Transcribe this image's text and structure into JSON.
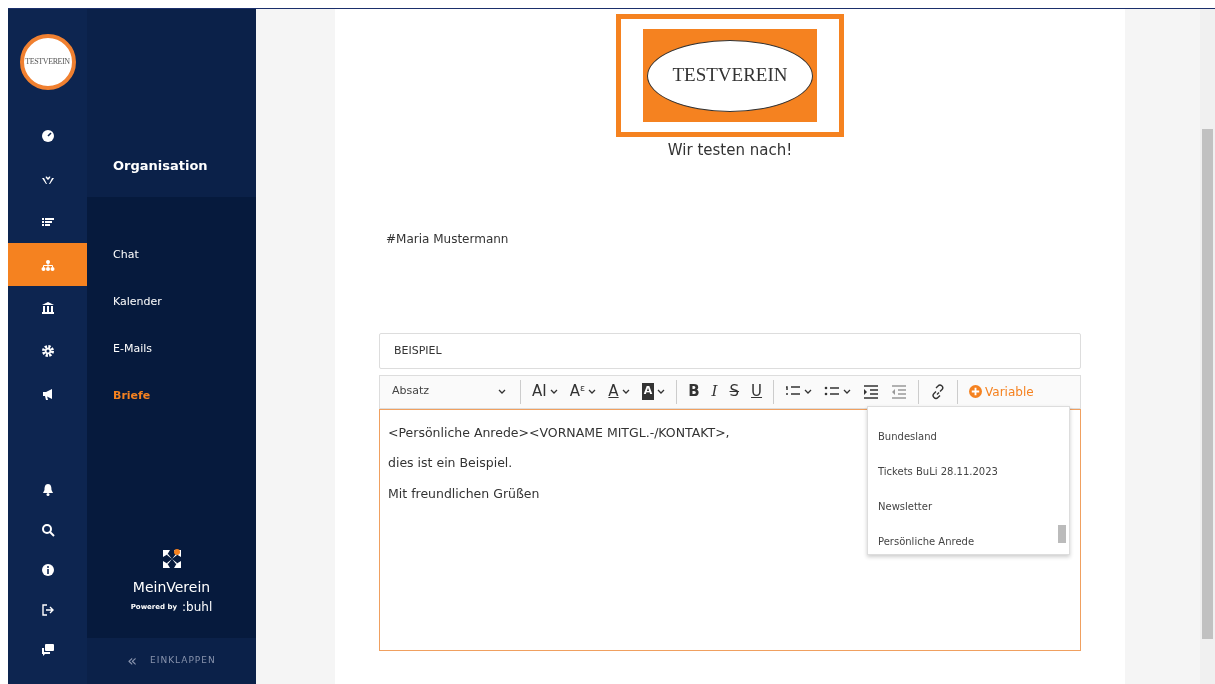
{
  "rail": {
    "logo_text": "TESTVEREIN",
    "nav": [
      {
        "kind": "gauge",
        "selected": false
      },
      {
        "kind": "hands",
        "selected": false
      },
      {
        "kind": "list",
        "selected": false
      },
      {
        "kind": "network",
        "selected": true
      },
      {
        "kind": "bank",
        "selected": false
      },
      {
        "kind": "gear",
        "selected": false
      },
      {
        "kind": "megaphone",
        "selected": false
      }
    ],
    "bottom": [
      {
        "kind": "bell"
      },
      {
        "kind": "search"
      },
      {
        "kind": "info"
      },
      {
        "kind": "logout"
      },
      {
        "kind": "chat"
      }
    ]
  },
  "submenu": {
    "title": "Organisation",
    "items": [
      {
        "label": "Chat",
        "selected": false
      },
      {
        "label": "Kalender",
        "selected": false
      },
      {
        "label": "E-Mails",
        "selected": false
      },
      {
        "label": "Briefe",
        "selected": true
      }
    ],
    "brand": {
      "name": "MeinVerein",
      "powered": "Powered by",
      "company": ":buhl"
    },
    "collapse": {
      "icon": "«",
      "label": "EINKLAPPEN"
    }
  },
  "document": {
    "logo_text": "TESTVEREIN",
    "caption": "Wir testen nach!",
    "recipient": "#Maria Mustermann",
    "subject": {
      "value": "BEISPIEL"
    },
    "toolbar": [
      {
        "kind": "select",
        "label": "Absatz"
      },
      {
        "kind": "sep"
      },
      {
        "kind": "glyph",
        "label": "AI",
        "caret": true
      },
      {
        "kind": "glyph",
        "label": "Aᵋ",
        "caret": true
      },
      {
        "kind": "underline-a",
        "label": "A",
        "caret": true
      },
      {
        "kind": "filled-a",
        "label": "A",
        "caret": true
      },
      {
        "kind": "sep"
      },
      {
        "kind": "bold",
        "label": "B"
      },
      {
        "kind": "italic",
        "label": "I"
      },
      {
        "kind": "strike",
        "label": "S"
      },
      {
        "kind": "underline",
        "label": "U"
      },
      {
        "kind": "sep"
      },
      {
        "kind": "ordered-list",
        "caret": true
      },
      {
        "kind": "bullet-list",
        "caret": true
      },
      {
        "kind": "indent"
      },
      {
        "kind": "outdent"
      },
      {
        "kind": "sep"
      },
      {
        "kind": "link"
      },
      {
        "kind": "sep"
      },
      {
        "kind": "variable",
        "label": "Variable"
      }
    ],
    "body": [
      "<Persönliche Anrede><VORNAME MITGL.-/KONTAKT>,",
      "dies ist ein Beispiel.",
      "Mit freundlichen Grüßen"
    ],
    "dropdown": [
      "Bundesland",
      "Tickets BuLi 28.11.2023",
      "Newsletter",
      "Persönliche Anrede"
    ]
  }
}
